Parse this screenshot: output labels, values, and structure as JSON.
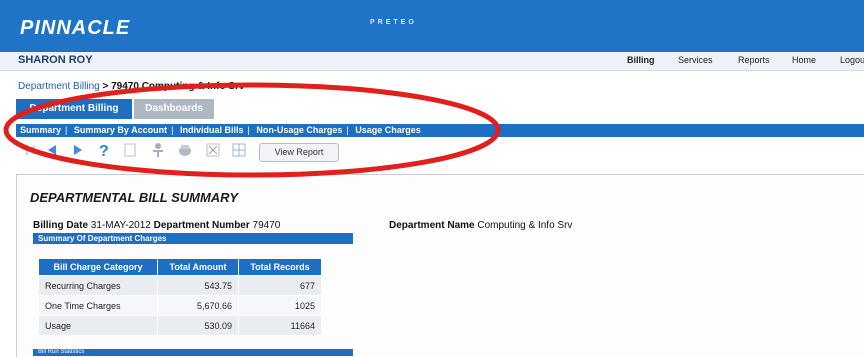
{
  "header": {
    "brand": "PINNACLE",
    "product": "PRETEO"
  },
  "userbar": {
    "user_name": "SHARON ROY",
    "nav": [
      "Billing",
      "Services",
      "Reports",
      "Home",
      "Logout"
    ]
  },
  "breadcrumb": {
    "link": "Department Billing",
    "separator": ">",
    "current": "79470 Computing & Info Srv"
  },
  "tabs": [
    "Department Billing",
    "Dashboards"
  ],
  "subnav": [
    "Summary",
    "Summary By Account",
    "Individual Bills",
    "Non-Usage Charges",
    "Usage Charges"
  ],
  "toolbar": {
    "icons": [
      "first-page-icon",
      "prev-page-icon",
      "next-page-icon",
      "help-icon",
      "document-icon",
      "tree-icon",
      "export-icon",
      "close-icon",
      "grid-icon"
    ],
    "view_report_label": "View Report"
  },
  "report": {
    "title": "DEPARTMENTAL BILL SUMMARY",
    "billing_date_label": "Billing Date",
    "billing_date": "31-MAY-2012",
    "dept_number_label": "Department Number",
    "dept_number": "79470",
    "dept_name_label": "Department Name",
    "dept_name": "Computing & Info Srv",
    "summary_header": "Summary Of Department Charges",
    "table": {
      "columns": [
        "Bill Charge Category",
        "Total Amount",
        "Total Records"
      ],
      "rows": [
        [
          "Recurring Charges",
          "543.75",
          "677"
        ],
        [
          "One Time Charges",
          "5,670.66",
          "1025"
        ],
        [
          "Usage",
          "530.09",
          "11664"
        ]
      ]
    },
    "run_stats_header": "Bill Run Statistics"
  },
  "colors": {
    "primary_blue": "#1e74c7",
    "highlight_red": "#e0201d"
  }
}
